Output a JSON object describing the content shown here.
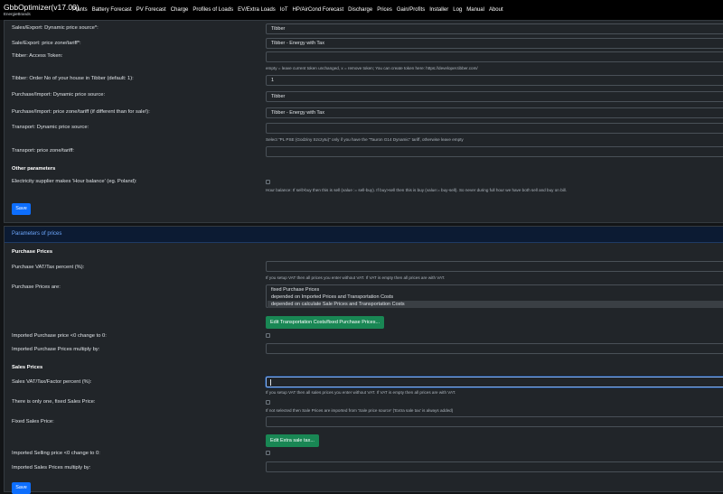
{
  "app": {
    "title": "GbbOptimizer(v17.00)",
    "subtitle": "EnergieBrands"
  },
  "nav": [
    "Plants",
    "Battery Forecast",
    "PV Forecast",
    "Charge",
    "Profiles of Loads",
    "EV/Extra Loads",
    "IoT",
    "HP/AirCond Forecast",
    "Discharge",
    "Prices",
    "Gain/Profits",
    "Installer",
    "Log",
    "Manual",
    "About"
  ],
  "tariff": {
    "sales_source_label": "Sales/Export: Dynamic price source*:",
    "sales_source_value": "Tibber",
    "sales_zone_label": "Sale/Export: price zone/tariff*:",
    "sales_zone_value": "Tibber - Energy with Tax",
    "token_label": "Tibber: Access Token:",
    "token_hint": "empty = leave current token unchanged, x = remove token; You can create token here: https://developer.tibber.com/",
    "order_label": "Tibber: Order No of your house in Tibber (default: 1):",
    "order_value": "1",
    "purchase_source_label": "Purchase/Import: Dynamic price source:",
    "purchase_source_value": "Tibber",
    "purchase_zone_label": "Purchase/Import: price zone/tariff (if different than for sale!):",
    "purchase_zone_value": "Tibber - Energy with Tax",
    "transport_source_label": "Transport: Dynamic price source:",
    "transport_hint": "Select \"PL PSE (Godziny Szczytu)\" only if you have the \"Tauron G14 Dynamic\" tariff, otherwise leave empty",
    "transport_zone_label": "Transport: price zone/tariff:",
    "other_heading": "Other parameters",
    "hour_balance_label": "Electricity supplier makes 'Hour balance' (eg. Poland):",
    "hour_balance_hint": "Hour balance: If sell>buy then this is sell (value := sell-buy). If buy>sell then this is buy (value:= buy-sell). So never during full hour we have both sell and buy on bill.",
    "save_label": "Save"
  },
  "prices": {
    "header": "Parameters of prices",
    "purchase_heading": "Purchase Prices",
    "purchase_vat_label": "Purchase VAT/Tax percent (%):",
    "purchase_vat_hint": "If you setup VAT then all prices you enter without VAT. If VAT is empty then all prices are with VAT.",
    "purchase_are_label": "Purchase Prices are:",
    "purchase_options": [
      "fixed Purchase Prices",
      "depended on Imported Prices and Transportation Costs",
      "depended on calculate Sale Prices and Transportation Costs"
    ],
    "purchase_selected_index": 2,
    "edit_transport_label": "Edit Transportation Costs/fixed Purchase Prices...",
    "imported_purchase_zero_label": "Imported Purchase price <0 change to 0:",
    "imported_purchase_multiply_label": "Imported Purchase Prices multiply by:",
    "sales_heading": "Sales Prices",
    "sales_vat_label": "Sales VAT/Tax/Factor percent (%):",
    "sales_vat_hint": "If you setup VAT then all sales prices you enter without VAT. If VAT is empty then all prices are with VAT.",
    "one_fixed_label": "There is only one, fixed Sales Price:",
    "one_fixed_hint": "If not selected then Sale Prices are imported from 'Sale price source' ('Extra sale tax' is always added)",
    "fixed_sales_label": "Fixed Sales Price:",
    "edit_extra_label": "Edit Extra sale tax...",
    "imported_selling_zero_label": "Imported Selling price <0 change to 0:",
    "imported_sales_multiply_label": "Imported Sales Prices multiply by:",
    "save_label": "Save"
  }
}
